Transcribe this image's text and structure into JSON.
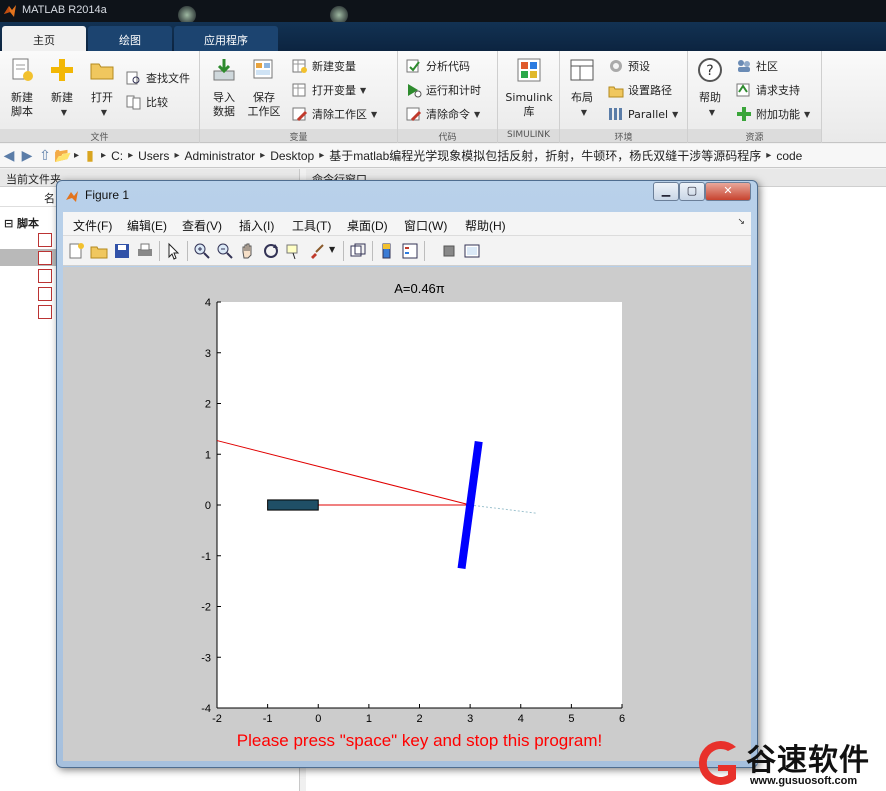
{
  "window": {
    "title": "MATLAB R2014a"
  },
  "tabs": [
    {
      "label": "主页",
      "active": true
    },
    {
      "label": "绘图",
      "active": false
    },
    {
      "label": "应用程序",
      "active": false
    }
  ],
  "ribbon": {
    "file": {
      "group_label": "文件",
      "new_script": "新建\n脚本",
      "new": "新建",
      "open": "打开",
      "find_files": "查找文件",
      "compare": "比较"
    },
    "variable": {
      "group_label": "变量",
      "import_data": "导入\n数据",
      "save_workspace": "保存\n工作区",
      "new_variable": "新建变量",
      "open_variable": "打开变量",
      "clear_workspace": "清除工作区"
    },
    "code": {
      "group_label": "代码",
      "analyze_code": "分析代码",
      "run_and_time": "运行和计时",
      "clear_commands": "清除命令"
    },
    "simulink": {
      "group_label": "SIMULINK",
      "library": "Simulink\n库"
    },
    "environment": {
      "group_label": "环境",
      "layout": "布局",
      "preferences": "预设",
      "set_path": "设置路径",
      "parallel": "Parallel"
    },
    "resources": {
      "group_label": "资源",
      "help": "帮助",
      "community": "社区",
      "request_support": "请求支持",
      "add_ons": "附加功能"
    }
  },
  "address": {
    "crumbs": [
      "C:",
      "Users",
      "Administrator",
      "Desktop",
      "基于matlab编程光学现象模拟包括反射，折射，牛顿环，杨氏双缝干涉等源码程序",
      "code"
    ]
  },
  "left_panel": {
    "title": "当前文件夹",
    "column_name": "名",
    "folder": "脚本"
  },
  "right_panel": {
    "title": "命令行窗口"
  },
  "figure": {
    "title": "Figure 1",
    "menus": [
      "文件(F)",
      "编辑(E)",
      "查看(V)",
      "插入(I)",
      "工具(T)",
      "桌面(D)",
      "窗口(W)",
      "帮助(H)"
    ]
  },
  "chart_data": {
    "type": "line",
    "title": "A=0.46π",
    "xlim": [
      -2,
      6
    ],
    "ylim": [
      -4,
      4
    ],
    "xticks": [
      -2,
      -1,
      0,
      1,
      2,
      3,
      4,
      5,
      6
    ],
    "yticks": [
      -4,
      -3,
      -2,
      -1,
      0,
      1,
      2,
      3,
      4
    ],
    "grid": false,
    "series": [
      {
        "style": "red-line",
        "color": "#e00000",
        "x": [
          0,
          3
        ],
        "y": [
          0,
          0
        ]
      },
      {
        "style": "red-line",
        "color": "#e00000",
        "x": [
          3,
          -2
        ],
        "y": [
          0,
          1.27
        ]
      },
      {
        "style": "dotted-line",
        "color": "#9ec3cf",
        "x": [
          3,
          4.3
        ],
        "y": [
          0,
          -0.16
        ]
      },
      {
        "style": "thick-line",
        "color": "#0000ff",
        "x": [
          2.83,
          3.17
        ],
        "y": [
          -1.25,
          1.25
        ]
      },
      {
        "style": "rectangle",
        "color": "#1f4f66",
        "x": [
          -1,
          0
        ],
        "y": [
          -0.1,
          0.1
        ]
      }
    ],
    "annotation": "Please press \"space\" key and stop this program!"
  },
  "watermark": {
    "name": "谷速软件",
    "url": "www.gusuosoft.com"
  }
}
